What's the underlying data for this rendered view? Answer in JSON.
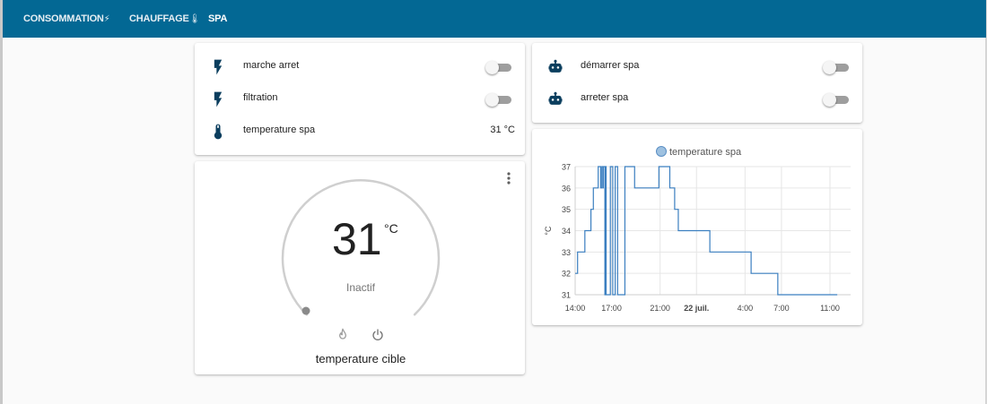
{
  "nav": {
    "tabs": [
      {
        "label": "CONSOMMATION",
        "emoji": "⚡"
      },
      {
        "label": "CHAUFFAGE",
        "emoji": "🌡"
      },
      {
        "label": "SPA",
        "emoji": ""
      }
    ],
    "active": "SPA"
  },
  "entities_left": {
    "rows": [
      {
        "label": "marche arret",
        "icon": "lightning-icon",
        "state": "off"
      },
      {
        "label": "filtration",
        "icon": "lightning-icon",
        "state": "off"
      },
      {
        "label": "temperature spa",
        "icon": "thermometer-icon",
        "value": "31 °C"
      }
    ]
  },
  "entities_right": {
    "rows": [
      {
        "label": "démarrer spa",
        "icon": "robot-icon",
        "state": "off"
      },
      {
        "label": "arreter spa",
        "icon": "robot-icon",
        "state": "off"
      }
    ]
  },
  "thermostat": {
    "current": "31",
    "unit": "°C",
    "mode": "Inactif",
    "name": "temperature cible",
    "icons": [
      "flame-icon",
      "power-icon"
    ]
  },
  "colors": {
    "header": "#036894",
    "icon": "#0b3e5e",
    "line": "#3b7fc0"
  },
  "chart_data": {
    "type": "line",
    "legend": "temperature spa",
    "ylabel": "°C",
    "ylim": [
      31,
      37
    ],
    "yticks": [
      "31",
      "32",
      "33",
      "34",
      "35",
      "36",
      "37"
    ],
    "xticks": [
      "14:00",
      "17:00",
      "21:00",
      "22 juil.",
      "4:00",
      "7:00",
      "11:00"
    ],
    "xtick_hours": [
      0,
      3,
      7,
      10,
      14,
      17,
      21
    ],
    "x_hours": [
      0,
      0.2,
      0.8,
      1.3,
      1.5,
      1.9,
      2.1,
      2.2,
      2.3,
      2.32,
      2.45,
      2.5,
      2.55,
      2.9,
      3.1,
      3.3,
      3.5,
      4.1,
      4.9,
      6.9,
      7.8,
      8.2,
      8.5,
      9.3,
      11.0,
      11.1,
      14.5,
      16.7,
      21.6
    ],
    "y": [
      32,
      33,
      34,
      35,
      36,
      37,
      36,
      37,
      36,
      37,
      31,
      37,
      31,
      37,
      31,
      37,
      31,
      37,
      36,
      37,
      36,
      35,
      34,
      34,
      34,
      33,
      32,
      31,
      31
    ]
  }
}
